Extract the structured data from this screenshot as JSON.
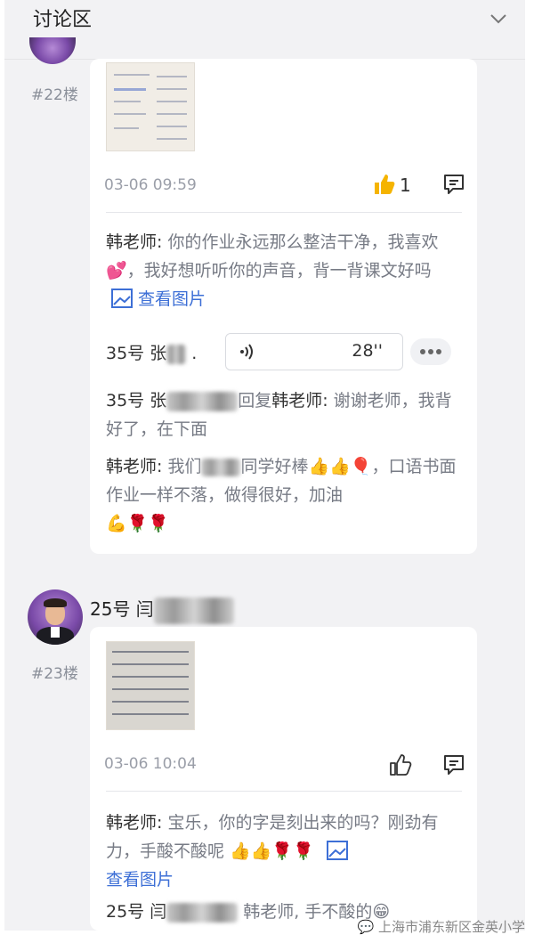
{
  "header": {
    "title": "讨论区"
  },
  "post22": {
    "floor": "#22楼",
    "timestamp": "03-06 09:59",
    "like_count": "1",
    "comment1": {
      "author": "韩老师:",
      "text": " 你的作业永远那么整洁干净，我喜欢💕，我好想听听你的声音，背一背课文好吗",
      "view_image": "查看图片"
    },
    "voice": {
      "label": "35号 张",
      "duration": "28''"
    },
    "comment2": {
      "author": "35号 张",
      "reply_word": "回复",
      "reply_to": "韩老师:",
      "text": " 谢谢老师，我背好了，在下面"
    },
    "comment3": {
      "author": "韩老师:",
      "text_a": " 我们",
      "text_b": "同学好棒",
      "emojis_a": "👍👍🎈",
      "text_c": "，口语书面作业一样不落，做得很好，加油",
      "emojis_b": "💪🌹🌹"
    }
  },
  "post23": {
    "username": "25号 闫",
    "floor": "#23楼",
    "timestamp": "03-06 10:04",
    "comment1": {
      "author": "韩老师:",
      "text": " 宝乐，你的字是刻出来的吗？刚劲有力，手酸不酸呢",
      "emojis": "👍👍🌹🌹",
      "view_image": "查看图片"
    },
    "comment2": {
      "author": "25号 闫",
      "reply_to": "韩老师,",
      "text": " 手不酸的",
      "emoji": "😁"
    }
  },
  "watermark": "上海市浦东新区金英小学"
}
